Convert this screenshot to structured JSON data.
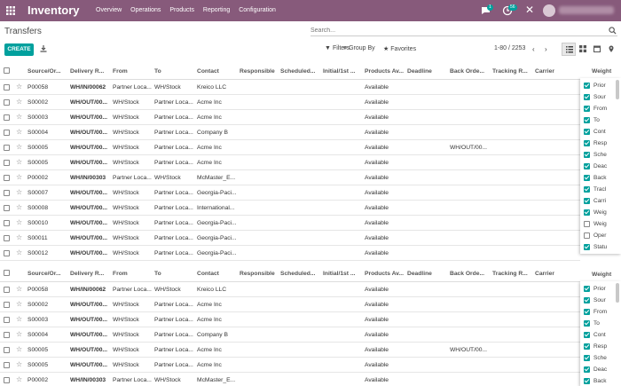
{
  "topbar": {
    "app_title": "Inventory",
    "menu": [
      "Overview",
      "Operations",
      "Products",
      "Reporting",
      "Configuration"
    ],
    "chat_badge": "1",
    "activity_badge": "56",
    "user_name": ""
  },
  "breadcrumb": "Transfers",
  "search": {
    "placeholder": "Search..."
  },
  "toolbar": {
    "create_label": "CREATE",
    "filters_label": "Filters",
    "groupby_label": "Group By",
    "favorites_label": "Favorites",
    "pager": "1-80 / 2253"
  },
  "columns": [
    "Source/Or...",
    "Delivery R...",
    "From",
    "To",
    "Contact",
    "Responsible",
    "Scheduled...",
    "Initial/1st ...",
    "Products Av...",
    "Deadline",
    "Back Orde...",
    "Tracking R...",
    "Carrier"
  ],
  "weight_header": "Weight",
  "rows_top": [
    {
      "source": "P00058",
      "ref": "WH/IN/00062",
      "from": "Partner Loca...",
      "to": "WH/Stock",
      "contact": "Kreico LLC",
      "avail": "Available",
      "backorder": ""
    },
    {
      "source": "S00002",
      "ref": "WH/OUT/00...",
      "from": "WH/Stock",
      "to": "Partner Loca...",
      "contact": "Acme Inc",
      "avail": "Available",
      "backorder": ""
    },
    {
      "source": "S00003",
      "ref": "WH/OUT/00...",
      "from": "WH/Stock",
      "to": "Partner Loca...",
      "contact": "Acme Inc",
      "avail": "Available",
      "backorder": ""
    },
    {
      "source": "S00004",
      "ref": "WH/OUT/00...",
      "from": "WH/Stock",
      "to": "Partner Loca...",
      "contact": "Company B",
      "avail": "Available",
      "backorder": ""
    },
    {
      "source": "S00005",
      "ref": "WH/OUT/00...",
      "from": "WH/Stock",
      "to": "Partner Loca...",
      "contact": "Acme Inc",
      "avail": "Available",
      "backorder": "WH/OUT/00..."
    },
    {
      "source": "S00005",
      "ref": "WH/OUT/00...",
      "from": "WH/Stock",
      "to": "Partner Loca...",
      "contact": "Acme Inc",
      "avail": "Available",
      "backorder": ""
    },
    {
      "source": "P00002",
      "ref": "WH/IN/00303",
      "from": "Partner Loca...",
      "to": "WH/Stock",
      "contact": "McMaster_E...",
      "avail": "Available",
      "backorder": ""
    },
    {
      "source": "S00007",
      "ref": "WH/OUT/00...",
      "from": "WH/Stock",
      "to": "Partner Loca...",
      "contact": "Georgia-Paci...",
      "avail": "Available",
      "backorder": ""
    },
    {
      "source": "S00008",
      "ref": "WH/OUT/00...",
      "from": "WH/Stock",
      "to": "Partner Loca...",
      "contact": "International...",
      "avail": "Available",
      "backorder": ""
    },
    {
      "source": "S00010",
      "ref": "WH/OUT/00...",
      "from": "WH/Stock",
      "to": "Partner Loca...",
      "contact": "Georgia-Paci...",
      "avail": "Available",
      "backorder": ""
    },
    {
      "source": "S00011",
      "ref": "WH/OUT/00...",
      "from": "WH/Stock",
      "to": "Partner Loca...",
      "contact": "Georgia-Paci...",
      "avail": "Available",
      "backorder": ""
    },
    {
      "source": "S00012",
      "ref": "WH/OUT/00...",
      "from": "WH/Stock",
      "to": "Partner Loca...",
      "contact": "Georgia-Paci...",
      "avail": "Available",
      "backorder": ""
    }
  ],
  "rows_bottom": [
    {
      "source": "P00058",
      "ref": "WH/IN/00062",
      "from": "Partner Loca...",
      "to": "WH/Stock",
      "contact": "Kreico LLC",
      "avail": "Available",
      "backorder": ""
    },
    {
      "source": "S00002",
      "ref": "WH/OUT/00...",
      "from": "WH/Stock",
      "to": "Partner Loca...",
      "contact": "Acme Inc",
      "avail": "Available",
      "backorder": ""
    },
    {
      "source": "S00003",
      "ref": "WH/OUT/00...",
      "from": "WH/Stock",
      "to": "Partner Loca...",
      "contact": "Acme Inc",
      "avail": "Available",
      "backorder": ""
    },
    {
      "source": "S00004",
      "ref": "WH/OUT/00...",
      "from": "WH/Stock",
      "to": "Partner Loca...",
      "contact": "Company B",
      "avail": "Available",
      "backorder": ""
    },
    {
      "source": "S00005",
      "ref": "WH/OUT/00...",
      "from": "WH/Stock",
      "to": "Partner Loca...",
      "contact": "Acme Inc",
      "avail": "Available",
      "backorder": "WH/OUT/00..."
    },
    {
      "source": "S00005",
      "ref": "WH/OUT/00...",
      "from": "WH/Stock",
      "to": "Partner Loca...",
      "contact": "Acme Inc",
      "avail": "Available",
      "backorder": ""
    },
    {
      "source": "P00002",
      "ref": "WH/IN/00303",
      "from": "Partner Loca...",
      "to": "WH/Stock",
      "contact": "McMaster_E...",
      "avail": "Available",
      "backorder": ""
    }
  ],
  "optional_columns_top": [
    {
      "label": "Prior",
      "on": true
    },
    {
      "label": "Sour",
      "on": true
    },
    {
      "label": "From",
      "on": true
    },
    {
      "label": "To",
      "on": true
    },
    {
      "label": "Cont",
      "on": true
    },
    {
      "label": "Resp",
      "on": true
    },
    {
      "label": "Sche",
      "on": true
    },
    {
      "label": "Deac",
      "on": true
    },
    {
      "label": "Back",
      "on": true
    },
    {
      "label": "Tracl",
      "on": true
    },
    {
      "label": "Carri",
      "on": true
    },
    {
      "label": "Weig",
      "on": true
    },
    {
      "label": "Weig",
      "on": false
    },
    {
      "label": "Oper",
      "on": false
    },
    {
      "label": "Statu",
      "on": true
    }
  ],
  "optional_columns_bottom": [
    {
      "label": "Prior",
      "on": true
    },
    {
      "label": "Sour",
      "on": true
    },
    {
      "label": "From",
      "on": true
    },
    {
      "label": "To",
      "on": true
    },
    {
      "label": "Cont",
      "on": true
    },
    {
      "label": "Resp",
      "on": true
    },
    {
      "label": "Sche",
      "on": true
    },
    {
      "label": "Deac",
      "on": true
    },
    {
      "label": "Back",
      "on": true
    }
  ],
  "colors": {
    "brand": "#875a7b",
    "accent": "#00a09d"
  }
}
